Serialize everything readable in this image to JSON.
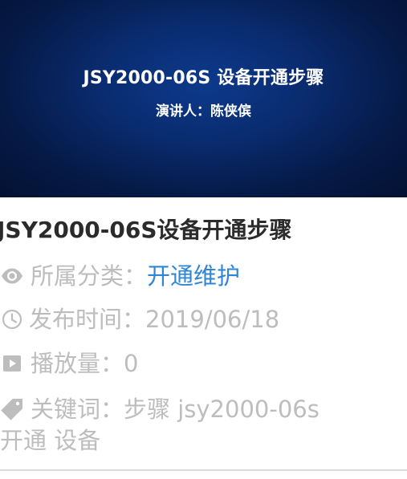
{
  "banner": {
    "title": "JSY2000-06S 设备开通步骤",
    "speaker": "演讲人：陈侠傧"
  },
  "video": {
    "title": "JSY2000-06S设备开通步骤"
  },
  "meta": {
    "category_label": "所属分类：",
    "category_value": "开通维护",
    "date_label": "发布时间：",
    "date_value": "2019/06/18",
    "plays_label": "播放量：",
    "plays_value": "0",
    "keywords_label": "关键词：",
    "keywords_line1": "步骤 jsy2000-06s",
    "keywords_line2": "开通 设备"
  },
  "icons": {
    "category": "eye-icon",
    "date": "clock-icon",
    "plays": "play-square-icon",
    "keywords": "tag-icon"
  },
  "colors": {
    "banner_bg": "#0a2c70",
    "title_text": "#2b2b2b",
    "meta_text": "#bdbdbd",
    "link": "#2f86d9"
  }
}
